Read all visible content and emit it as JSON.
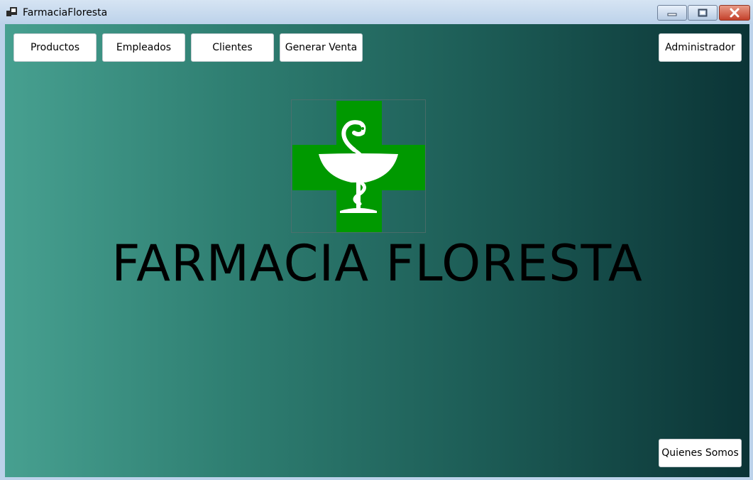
{
  "window": {
    "title": "FarmaciaFloresta",
    "controls": [
      "minimize-icon",
      "maximize-icon",
      "close-icon"
    ]
  },
  "nav": {
    "productos": "Productos",
    "empleados": "Empleados",
    "clientes": "Clientes",
    "generar_venta": "Generar Venta",
    "administrador": "Administrador"
  },
  "main": {
    "logo_icon": "pharmacy-cross-bowl-of-hygieia-icon",
    "brand_title": "FARMACIA FLORESTA"
  },
  "footer": {
    "quienes_somos": "Quienes Somos"
  },
  "colors": {
    "cross_green": "#009900",
    "background_gradient_start": "#47a090",
    "background_gradient_end": "#0b3436"
  }
}
